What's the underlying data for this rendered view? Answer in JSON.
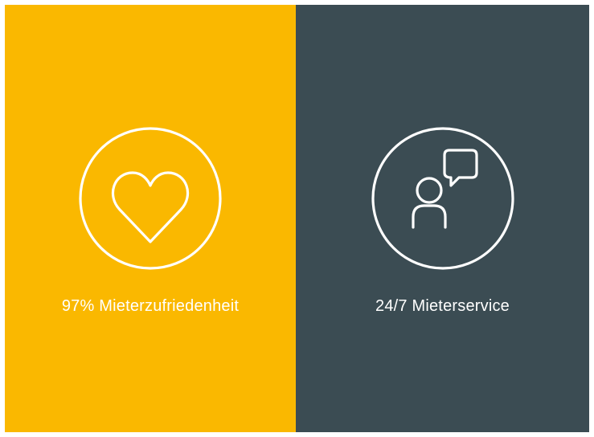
{
  "panels": {
    "left": {
      "caption": "97% Mieterzufriedenheit",
      "icon": "heart-icon",
      "background": "#FAB800"
    },
    "right": {
      "caption": "24/7 Mieterservice",
      "icon": "user-chat-icon",
      "background": "#3B4C53"
    }
  },
  "colors": {
    "foreground": "#FFFFFF"
  }
}
